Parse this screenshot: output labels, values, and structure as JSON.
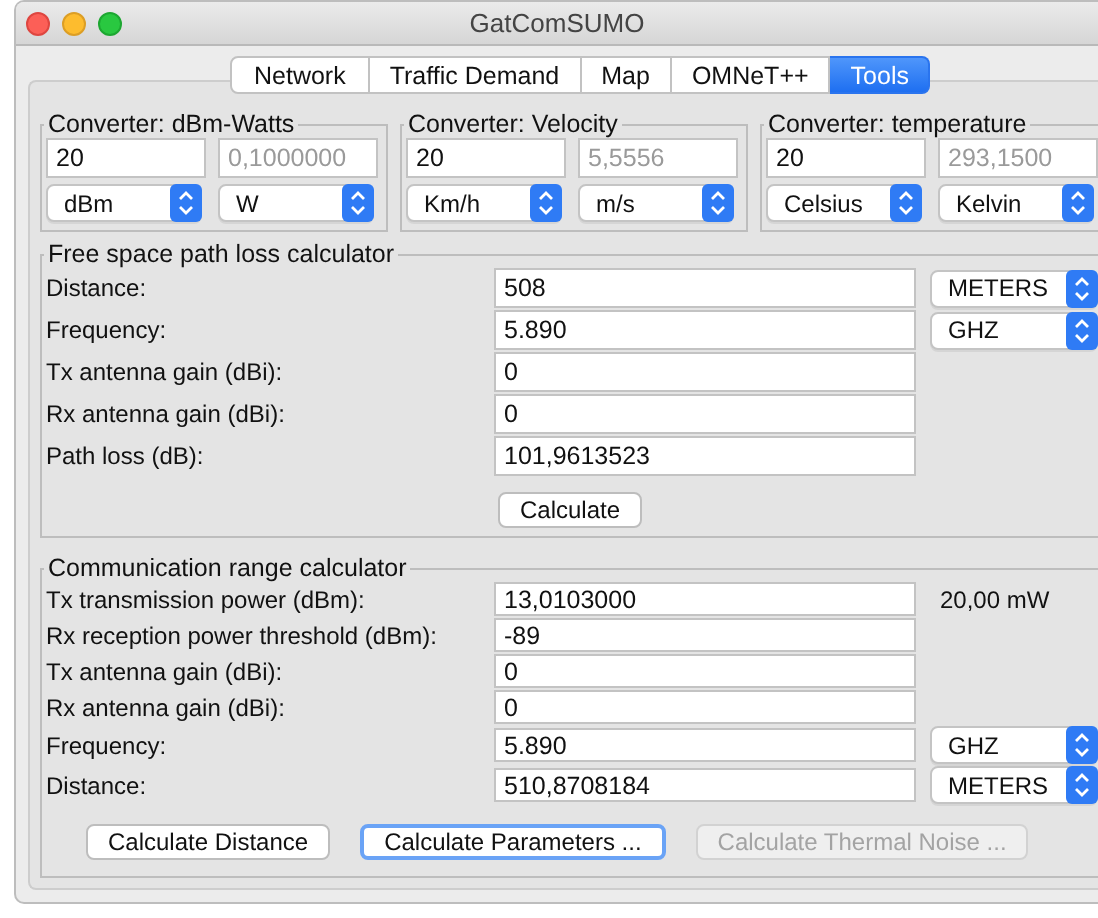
{
  "window": {
    "title": "GatComSUMO"
  },
  "tabs": [
    {
      "label": "Network",
      "selected": false
    },
    {
      "label": "Traffic Demand",
      "selected": false
    },
    {
      "label": "Map",
      "selected": false
    },
    {
      "label": "OMNeT++",
      "selected": false
    },
    {
      "label": "Tools",
      "selected": true
    }
  ],
  "converters": [
    {
      "title": "Converter: dBm-Watts",
      "input": "20",
      "result": "0,1000000",
      "from_unit": "dBm",
      "to_unit": "W"
    },
    {
      "title": "Converter: Velocity",
      "input": "20",
      "result": "5,5556",
      "from_unit": "Km/h",
      "to_unit": "m/s"
    },
    {
      "title": "Converter: temperature",
      "input": "20",
      "result": "293,1500",
      "from_unit": "Celsius",
      "to_unit": "Kelvin"
    }
  ],
  "path_loss": {
    "title": "Free space path loss calculator",
    "rows": [
      {
        "label": "Distance:",
        "value": "508",
        "unit": "METERS"
      },
      {
        "label": "Frequency:",
        "value": "5.890",
        "unit": "GHZ"
      },
      {
        "label": "Tx antenna gain (dBi):",
        "value": "0"
      },
      {
        "label": "Rx antenna gain (dBi):",
        "value": "0"
      },
      {
        "label": "Path loss (dB):",
        "value": "101,9613523"
      }
    ],
    "button": "Calculate"
  },
  "range": {
    "title": "Communication range calculator",
    "rows": [
      {
        "label": "Tx transmission power (dBm):",
        "value": "13,0103000",
        "note": "20,00 mW"
      },
      {
        "label": "Rx reception power threshold (dBm):",
        "value": "-89"
      },
      {
        "label": "Tx antenna gain (dBi):",
        "value": "0"
      },
      {
        "label": "Rx antenna gain (dBi):",
        "value": "0"
      },
      {
        "label": "Frequency:",
        "value": "5.890",
        "unit": "GHZ"
      },
      {
        "label": "Distance:",
        "value": "510,8708184",
        "unit": "METERS"
      }
    ],
    "buttons": [
      {
        "label": "Calculate Distance",
        "focused": false,
        "disabled": false
      },
      {
        "label": "Calculate Parameters ...",
        "focused": true,
        "disabled": false
      },
      {
        "label": "Calculate Thermal Noise ...",
        "focused": false,
        "disabled": true
      }
    ]
  }
}
